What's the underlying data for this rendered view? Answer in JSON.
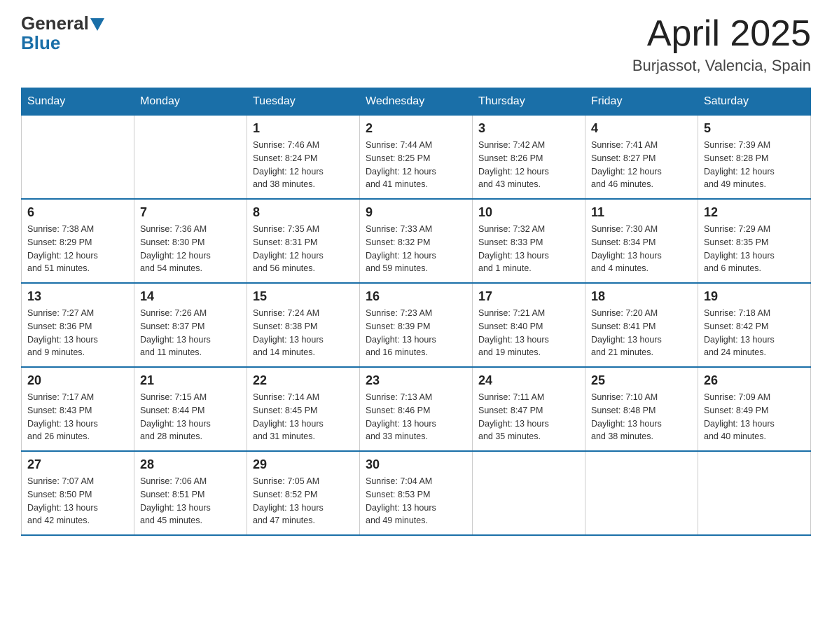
{
  "logo": {
    "text_general": "General",
    "text_blue": "Blue"
  },
  "header": {
    "month": "April 2025",
    "location": "Burjassot, Valencia, Spain"
  },
  "weekdays": [
    "Sunday",
    "Monday",
    "Tuesday",
    "Wednesday",
    "Thursday",
    "Friday",
    "Saturday"
  ],
  "weeks": [
    [
      {
        "day": "",
        "info": ""
      },
      {
        "day": "",
        "info": ""
      },
      {
        "day": "1",
        "info": "Sunrise: 7:46 AM\nSunset: 8:24 PM\nDaylight: 12 hours\nand 38 minutes."
      },
      {
        "day": "2",
        "info": "Sunrise: 7:44 AM\nSunset: 8:25 PM\nDaylight: 12 hours\nand 41 minutes."
      },
      {
        "day": "3",
        "info": "Sunrise: 7:42 AM\nSunset: 8:26 PM\nDaylight: 12 hours\nand 43 minutes."
      },
      {
        "day": "4",
        "info": "Sunrise: 7:41 AM\nSunset: 8:27 PM\nDaylight: 12 hours\nand 46 minutes."
      },
      {
        "day": "5",
        "info": "Sunrise: 7:39 AM\nSunset: 8:28 PM\nDaylight: 12 hours\nand 49 minutes."
      }
    ],
    [
      {
        "day": "6",
        "info": "Sunrise: 7:38 AM\nSunset: 8:29 PM\nDaylight: 12 hours\nand 51 minutes."
      },
      {
        "day": "7",
        "info": "Sunrise: 7:36 AM\nSunset: 8:30 PM\nDaylight: 12 hours\nand 54 minutes."
      },
      {
        "day": "8",
        "info": "Sunrise: 7:35 AM\nSunset: 8:31 PM\nDaylight: 12 hours\nand 56 minutes."
      },
      {
        "day": "9",
        "info": "Sunrise: 7:33 AM\nSunset: 8:32 PM\nDaylight: 12 hours\nand 59 minutes."
      },
      {
        "day": "10",
        "info": "Sunrise: 7:32 AM\nSunset: 8:33 PM\nDaylight: 13 hours\nand 1 minute."
      },
      {
        "day": "11",
        "info": "Sunrise: 7:30 AM\nSunset: 8:34 PM\nDaylight: 13 hours\nand 4 minutes."
      },
      {
        "day": "12",
        "info": "Sunrise: 7:29 AM\nSunset: 8:35 PM\nDaylight: 13 hours\nand 6 minutes."
      }
    ],
    [
      {
        "day": "13",
        "info": "Sunrise: 7:27 AM\nSunset: 8:36 PM\nDaylight: 13 hours\nand 9 minutes."
      },
      {
        "day": "14",
        "info": "Sunrise: 7:26 AM\nSunset: 8:37 PM\nDaylight: 13 hours\nand 11 minutes."
      },
      {
        "day": "15",
        "info": "Sunrise: 7:24 AM\nSunset: 8:38 PM\nDaylight: 13 hours\nand 14 minutes."
      },
      {
        "day": "16",
        "info": "Sunrise: 7:23 AM\nSunset: 8:39 PM\nDaylight: 13 hours\nand 16 minutes."
      },
      {
        "day": "17",
        "info": "Sunrise: 7:21 AM\nSunset: 8:40 PM\nDaylight: 13 hours\nand 19 minutes."
      },
      {
        "day": "18",
        "info": "Sunrise: 7:20 AM\nSunset: 8:41 PM\nDaylight: 13 hours\nand 21 minutes."
      },
      {
        "day": "19",
        "info": "Sunrise: 7:18 AM\nSunset: 8:42 PM\nDaylight: 13 hours\nand 24 minutes."
      }
    ],
    [
      {
        "day": "20",
        "info": "Sunrise: 7:17 AM\nSunset: 8:43 PM\nDaylight: 13 hours\nand 26 minutes."
      },
      {
        "day": "21",
        "info": "Sunrise: 7:15 AM\nSunset: 8:44 PM\nDaylight: 13 hours\nand 28 minutes."
      },
      {
        "day": "22",
        "info": "Sunrise: 7:14 AM\nSunset: 8:45 PM\nDaylight: 13 hours\nand 31 minutes."
      },
      {
        "day": "23",
        "info": "Sunrise: 7:13 AM\nSunset: 8:46 PM\nDaylight: 13 hours\nand 33 minutes."
      },
      {
        "day": "24",
        "info": "Sunrise: 7:11 AM\nSunset: 8:47 PM\nDaylight: 13 hours\nand 35 minutes."
      },
      {
        "day": "25",
        "info": "Sunrise: 7:10 AM\nSunset: 8:48 PM\nDaylight: 13 hours\nand 38 minutes."
      },
      {
        "day": "26",
        "info": "Sunrise: 7:09 AM\nSunset: 8:49 PM\nDaylight: 13 hours\nand 40 minutes."
      }
    ],
    [
      {
        "day": "27",
        "info": "Sunrise: 7:07 AM\nSunset: 8:50 PM\nDaylight: 13 hours\nand 42 minutes."
      },
      {
        "day": "28",
        "info": "Sunrise: 7:06 AM\nSunset: 8:51 PM\nDaylight: 13 hours\nand 45 minutes."
      },
      {
        "day": "29",
        "info": "Sunrise: 7:05 AM\nSunset: 8:52 PM\nDaylight: 13 hours\nand 47 minutes."
      },
      {
        "day": "30",
        "info": "Sunrise: 7:04 AM\nSunset: 8:53 PM\nDaylight: 13 hours\nand 49 minutes."
      },
      {
        "day": "",
        "info": ""
      },
      {
        "day": "",
        "info": ""
      },
      {
        "day": "",
        "info": ""
      }
    ]
  ]
}
